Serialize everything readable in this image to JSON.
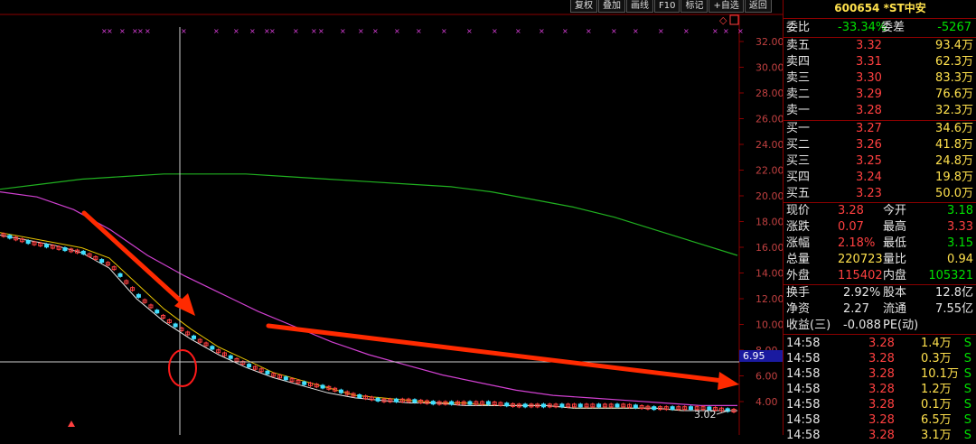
{
  "toolbar": {
    "items": [
      "复权",
      "叠加",
      "画线",
      "F10",
      "标记",
      "+自选",
      "返回"
    ]
  },
  "axis": {
    "ticks": [
      "32.00",
      "30.00",
      "28.00",
      "26.00",
      "24.00",
      "22.00",
      "20.00",
      "18.00",
      "16.00",
      "14.00",
      "12.00",
      "10.00",
      "8.00",
      "6.00",
      "4.00"
    ],
    "crosshair_price": "6.95",
    "low_label": "3.02"
  },
  "stock": {
    "code": "600654",
    "name": "*ST中安"
  },
  "commission": {
    "ratio_label": "委比",
    "ratio": "-33.34%",
    "diff_label": "委差",
    "diff": "-5267"
  },
  "asks": [
    {
      "label": "卖五",
      "price": "3.32",
      "vol": "93.4万"
    },
    {
      "label": "卖四",
      "price": "3.31",
      "vol": "62.3万"
    },
    {
      "label": "卖三",
      "price": "3.30",
      "vol": "83.3万"
    },
    {
      "label": "卖二",
      "price": "3.29",
      "vol": "76.6万"
    },
    {
      "label": "卖一",
      "price": "3.28",
      "vol": "32.3万"
    }
  ],
  "bids": [
    {
      "label": "买一",
      "price": "3.27",
      "vol": "34.6万"
    },
    {
      "label": "买二",
      "price": "3.26",
      "vol": "41.8万"
    },
    {
      "label": "买三",
      "price": "3.25",
      "vol": "24.8万"
    },
    {
      "label": "买四",
      "price": "3.24",
      "vol": "19.8万"
    },
    {
      "label": "买五",
      "price": "3.23",
      "vol": "50.0万"
    }
  ],
  "quote": [
    {
      "l1": "现价",
      "v1": "3.28",
      "c1": "red",
      "l2": "今开",
      "v2": "3.18",
      "c2": "green"
    },
    {
      "l1": "涨跌",
      "v1": "0.07",
      "c1": "red",
      "l2": "最高",
      "v2": "3.33",
      "c2": "red"
    },
    {
      "l1": "涨幅",
      "v1": "2.18%",
      "c1": "red",
      "l2": "最低",
      "v2": "3.15",
      "c2": "green"
    },
    {
      "l1": "总量",
      "v1": "220723",
      "c1": "yellow",
      "l2": "量比",
      "v2": "0.94",
      "c2": "yellow"
    },
    {
      "l1": "外盘",
      "v1": "115402",
      "c1": "red",
      "l2": "内盘",
      "v2": "105321",
      "c2": "green"
    }
  ],
  "fundamentals": [
    {
      "l1": "换手",
      "v1": "2.92%",
      "l2": "股本",
      "v2": "12.8亿"
    },
    {
      "l1": "净资",
      "v1": "2.27",
      "l2": "流通",
      "v2": "7.55亿"
    },
    {
      "l1": "收益(三)",
      "v1": "-0.088",
      "l2": "PE(动)",
      "v2": ""
    }
  ],
  "trades": [
    {
      "time": "14:58",
      "price": "3.28",
      "vol": "1.4万",
      "side": "S"
    },
    {
      "time": "14:58",
      "price": "3.28",
      "vol": "0.3万",
      "side": "S"
    },
    {
      "time": "14:58",
      "price": "3.28",
      "vol": "10.1万",
      "side": "S"
    },
    {
      "time": "14:58",
      "price": "3.28",
      "vol": "1.2万",
      "side": "S"
    },
    {
      "time": "14:58",
      "price": "3.28",
      "vol": "0.1万",
      "side": "S"
    },
    {
      "time": "14:58",
      "price": "3.28",
      "vol": "6.5万",
      "side": "S"
    },
    {
      "time": "14:58",
      "price": "3.28",
      "vol": "3.1万",
      "side": "S"
    }
  ],
  "colors": {
    "ma_white": "#e8e8e8",
    "ma_yellow": "#e6c200",
    "ma_magenta": "#d040d0",
    "ma_green": "#20b020",
    "arrow": "#ff2a00",
    "axis": "#8b0000",
    "marker": "#e040e0"
  },
  "chart_data": {
    "type": "line",
    "ylim": [
      3.0,
      32.0
    ],
    "price_series": [
      9.8,
      9.5,
      9.3,
      9.1,
      8.6,
      7.4,
      6.5,
      5.8,
      5.2,
      4.7,
      4.3,
      4.0,
      3.8,
      3.5,
      3.3,
      3.3,
      3.2,
      3.2,
      3.2,
      3.1,
      3.1,
      3.1,
      3.1,
      3.1,
      3.0,
      3.0,
      3.0,
      2.9
    ],
    "ma_white": [
      9.8,
      9.6,
      9.4,
      9.1,
      8.5,
      7.3,
      6.4,
      5.7,
      5.1,
      4.6,
      4.2,
      3.9,
      3.6,
      3.4,
      3.3,
      3.2,
      3.2,
      3.1,
      3.1,
      3.1,
      3.1,
      3.0,
      3.0,
      3.0,
      3.0,
      2.9,
      2.9,
      2.9
    ],
    "ma_yellow": [
      9.9,
      9.7,
      9.5,
      9.3,
      8.9,
      7.9,
      6.9,
      6.1,
      5.4,
      4.9,
      4.4,
      4.1,
      3.8,
      3.5,
      3.4,
      3.3,
      3.2,
      3.2,
      3.1,
      3.1,
      3.1,
      3.0,
      3.0,
      3.0,
      3.0,
      2.9,
      2.9,
      2.9
    ],
    "ma_magenta": [
      11.5,
      11.3,
      10.8,
      10.0,
      9.0,
      8.2,
      7.5,
      6.8,
      6.2,
      5.6,
      5.1,
      4.7,
      4.3,
      4.0,
      3.7,
      3.5,
      3.4,
      3.3,
      3.2,
      3.1,
      3.1
    ],
    "ma_green": [
      11.6,
      11.8,
      12.0,
      12.1,
      12.2,
      12.2,
      12.2,
      12.1,
      12.0,
      11.9,
      11.8,
      11.7,
      11.5,
      11.2,
      10.9,
      10.5,
      10.0,
      9.5,
      9.0
    ]
  }
}
